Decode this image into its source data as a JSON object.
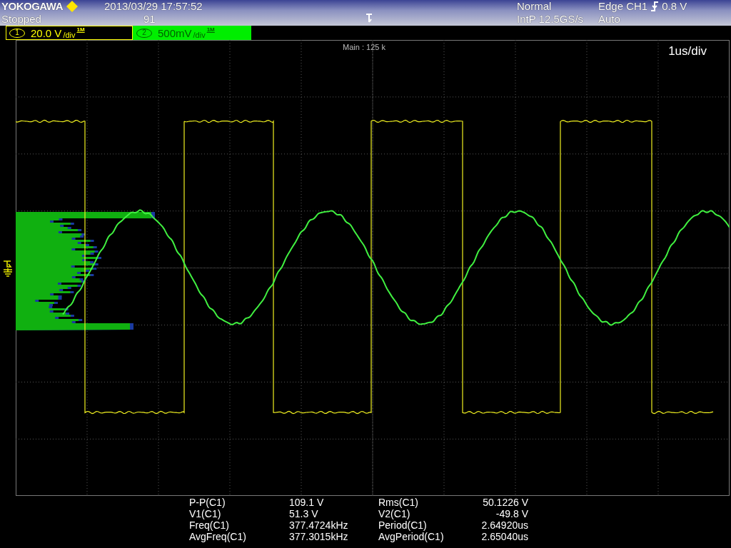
{
  "header": {
    "brand": "YOKOGAWA",
    "datetime": "2013/03/29  17:57:52",
    "run_state": "Stopped",
    "acq_count": "91",
    "trigger_mode": "Normal",
    "sampling": "IntP  12.5GS/s",
    "trigger_type": "Edge CH1",
    "trigger_value": "0.8 V",
    "trigger_auto": "Auto"
  },
  "channels": [
    {
      "number": "1",
      "scale": "20.0 V",
      "unit": "/div",
      "impedance": "1M",
      "color": "#ffff00",
      "selected": false
    },
    {
      "number": "2",
      "scale": "500mV",
      "unit": "/div",
      "impedance": "1M",
      "color": "#00ee00",
      "selected": true
    }
  ],
  "display": {
    "zoom_label": "Main : 125 k",
    "timebase": "1us/div"
  },
  "measurements": [
    {
      "name": "P-P(C1)",
      "value": "109.1 V",
      "name2": "Rms(C1)",
      "value2": "50.1226 V"
    },
    {
      "name": "V1(C1)",
      "value": "51.3 V",
      "name2": "V2(C1)",
      "value2": "-49.8 V"
    },
    {
      "name": "Freq(C1)",
      "value": "377.4724kHz",
      "name2": "Period(C1)",
      "value2": "2.64920us"
    },
    {
      "name": "AvgFreq(C1)",
      "value": "377.3015kHz",
      "name2": "AvgPeriod(C1)",
      "value2": "2.65040us"
    }
  ]
}
